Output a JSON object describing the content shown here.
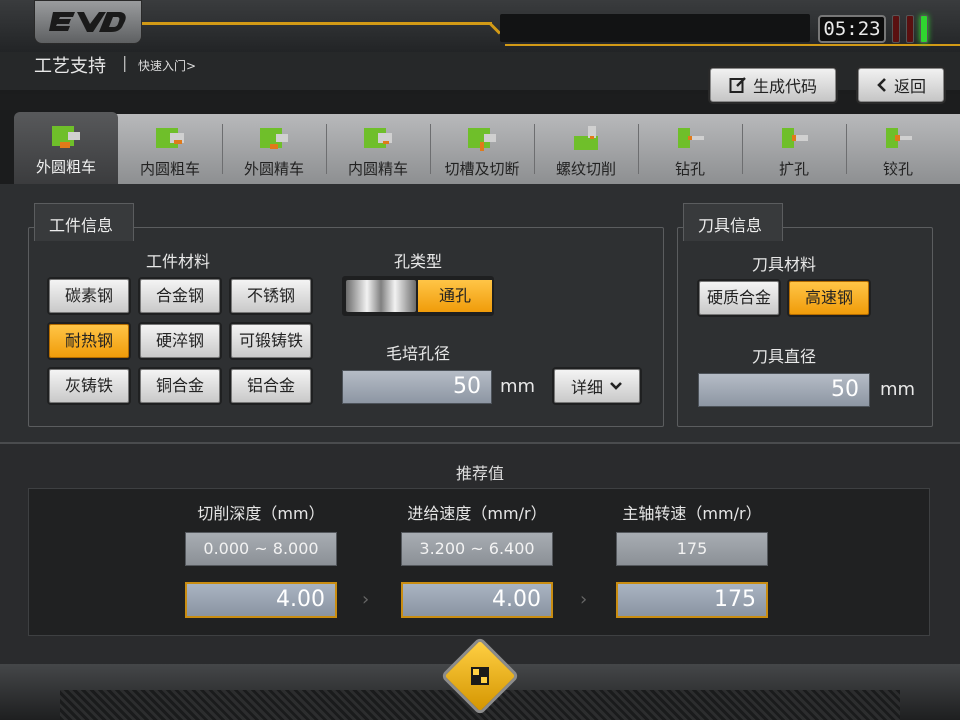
{
  "header": {
    "logo": "EVD",
    "time": "05:23",
    "title": "工艺支持",
    "separator": "|",
    "breadcrumb": "快速入门>"
  },
  "buttons": {
    "generate": "生成代码",
    "back": "返回"
  },
  "tabs": [
    {
      "label": "外圆粗车",
      "active": true
    },
    {
      "label": "内圆粗车"
    },
    {
      "label": "外圆精车"
    },
    {
      "label": "内圆精车"
    },
    {
      "label": "切槽及切断"
    },
    {
      "label": "螺纹切削"
    },
    {
      "label": "钻孔"
    },
    {
      "label": "扩孔"
    },
    {
      "label": "铰孔"
    }
  ],
  "workpiece": {
    "title": "工件信息",
    "material_label": "工件材料",
    "materials": [
      "碳素钢",
      "合金钢",
      "不锈钢",
      "耐热钢",
      "硬淬钢",
      "可锻铸铁",
      "灰铸铁",
      "铜合金",
      "铝合金"
    ],
    "selected_material": "耐热钢",
    "hole_type_label": "孔类型",
    "hole_type": "通孔",
    "blank_hole_label": "毛培孔径",
    "blank_hole_value": "50",
    "unit": "mm",
    "detail_button": "详细"
  },
  "tool": {
    "title": "刀具信息",
    "material_label": "刀具材料",
    "materials": [
      "硬质合金",
      "高速钢"
    ],
    "selected_material": "高速钢",
    "diameter_label": "刀具直径",
    "diameter_value": "50",
    "unit": "mm"
  },
  "recommend": {
    "title": "推荐值",
    "columns": [
      {
        "label": "切削深度（mm）",
        "range": "0.000 ~ 8.000",
        "value": "4.00"
      },
      {
        "label": "进给速度（mm/r）",
        "range": "3.200 ~ 6.400",
        "value": "4.00"
      },
      {
        "label": "主轴转速（mm/r）",
        "range": "175",
        "value": "175"
      }
    ]
  },
  "colors": {
    "accent": "#f0a010",
    "panel": "#2e3032"
  }
}
